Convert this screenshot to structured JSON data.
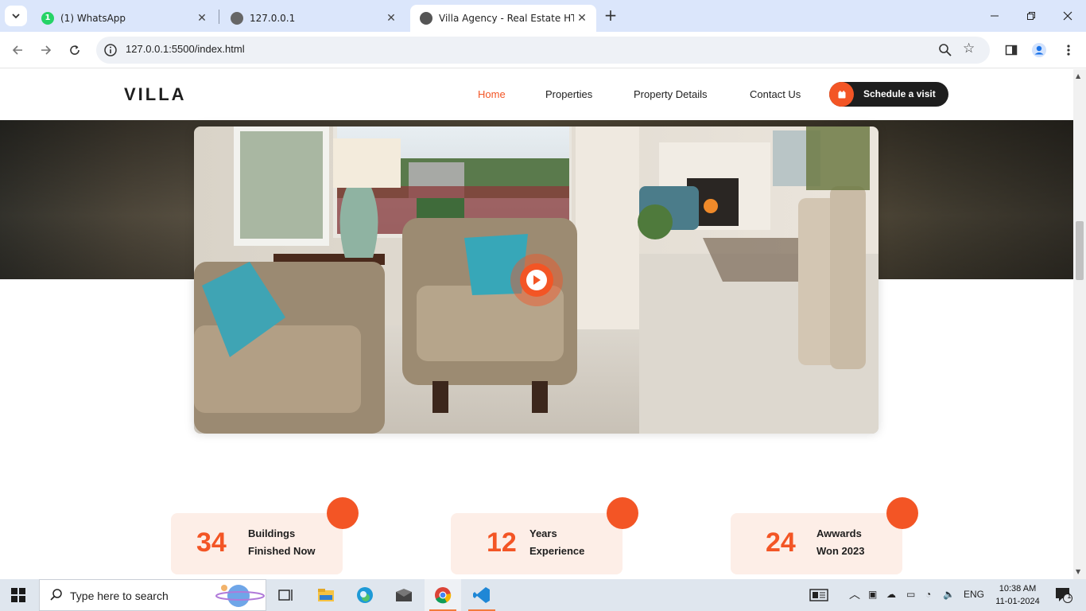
{
  "browser": {
    "tabs": [
      {
        "title": "(1) WhatsApp",
        "badge": "1",
        "active": false
      },
      {
        "title": "127.0.0.1",
        "active": false
      },
      {
        "title": "Villa Agency - Real Estate HTML",
        "active": true
      }
    ],
    "url": "127.0.0.1:5500/index.html"
  },
  "page": {
    "logo": "VILLA",
    "nav": [
      "Home",
      "Properties",
      "Property Details",
      "Contact Us"
    ],
    "cta_label": "Schedule a visit",
    "stats": [
      {
        "number": "34",
        "line1": "Buildings",
        "line2": "Finished Now"
      },
      {
        "number": "12",
        "line1": "Years",
        "line2": "Experience"
      },
      {
        "number": "24",
        "line1": "Awwards",
        "line2": "Won 2023"
      }
    ],
    "accent_color": "#f35525",
    "dark_color": "#1e1e1e"
  },
  "taskbar": {
    "search_placeholder": "Type here to search",
    "language": "ENG",
    "time": "10:38 AM",
    "date": "11-01-2024",
    "notification_count": "1"
  }
}
